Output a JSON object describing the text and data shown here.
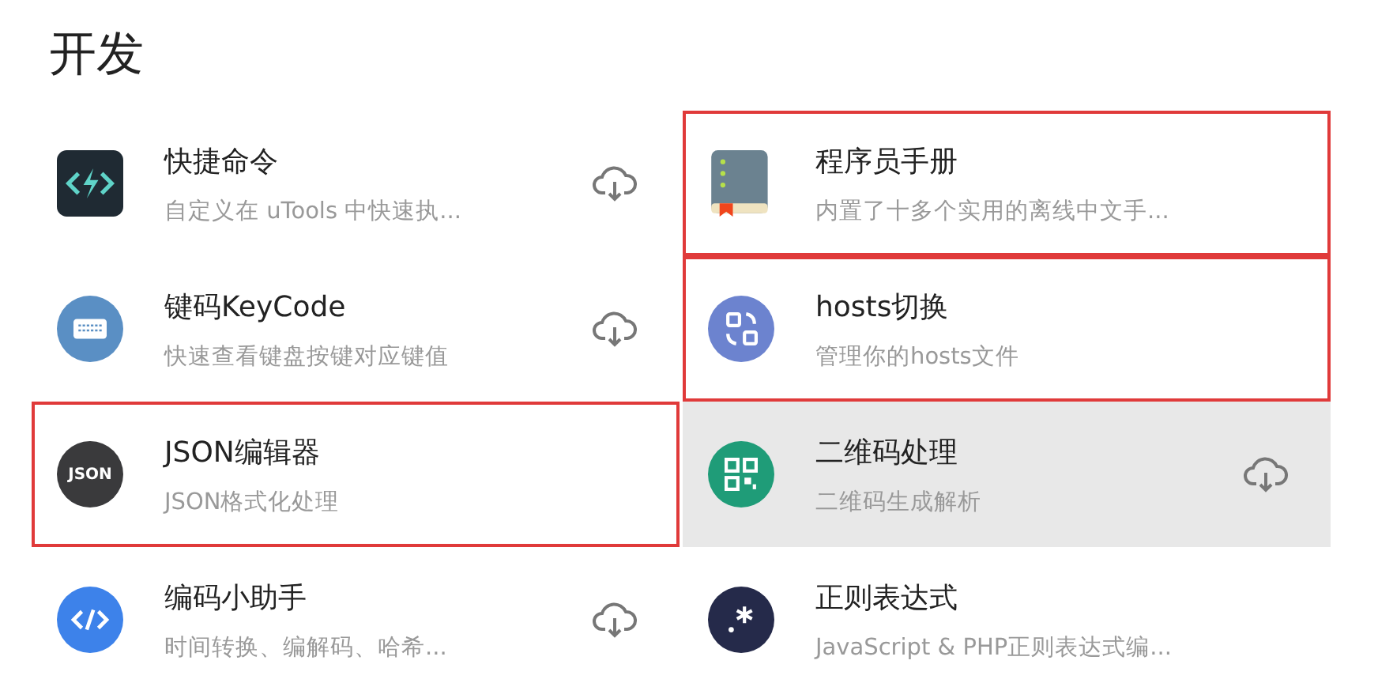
{
  "section_title": "开发",
  "items": [
    {
      "name": "快捷命令",
      "description": "自定义在 uTools 中快速执...",
      "downloadable": true,
      "highlighted": false,
      "hovered": false
    },
    {
      "name": "程序员手册",
      "description": "内置了十多个实用的离线中文手...",
      "downloadable": false,
      "highlighted": true,
      "hovered": false
    },
    {
      "name": "键码KeyCode",
      "description": "快速查看键盘按键对应键值",
      "downloadable": true,
      "highlighted": false,
      "hovered": false
    },
    {
      "name": "hosts切换",
      "description": "管理你的hosts文件",
      "downloadable": false,
      "highlighted": true,
      "hovered": false
    },
    {
      "name": "JSON编辑器",
      "description": "JSON格式化处理",
      "icon_label": "JSON",
      "downloadable": false,
      "highlighted": true,
      "hovered": false
    },
    {
      "name": "二维码处理",
      "description": "二维码生成解析",
      "downloadable": true,
      "highlighted": false,
      "hovered": true
    },
    {
      "name": "编码小助手",
      "description": "时间转换、编解码、哈希...",
      "downloadable": true,
      "highlighted": false,
      "hovered": false
    },
    {
      "name": "正则表达式",
      "description": "JavaScript & PHP正则表达式编...",
      "downloadable": false,
      "highlighted": false,
      "hovered": false
    }
  ]
}
